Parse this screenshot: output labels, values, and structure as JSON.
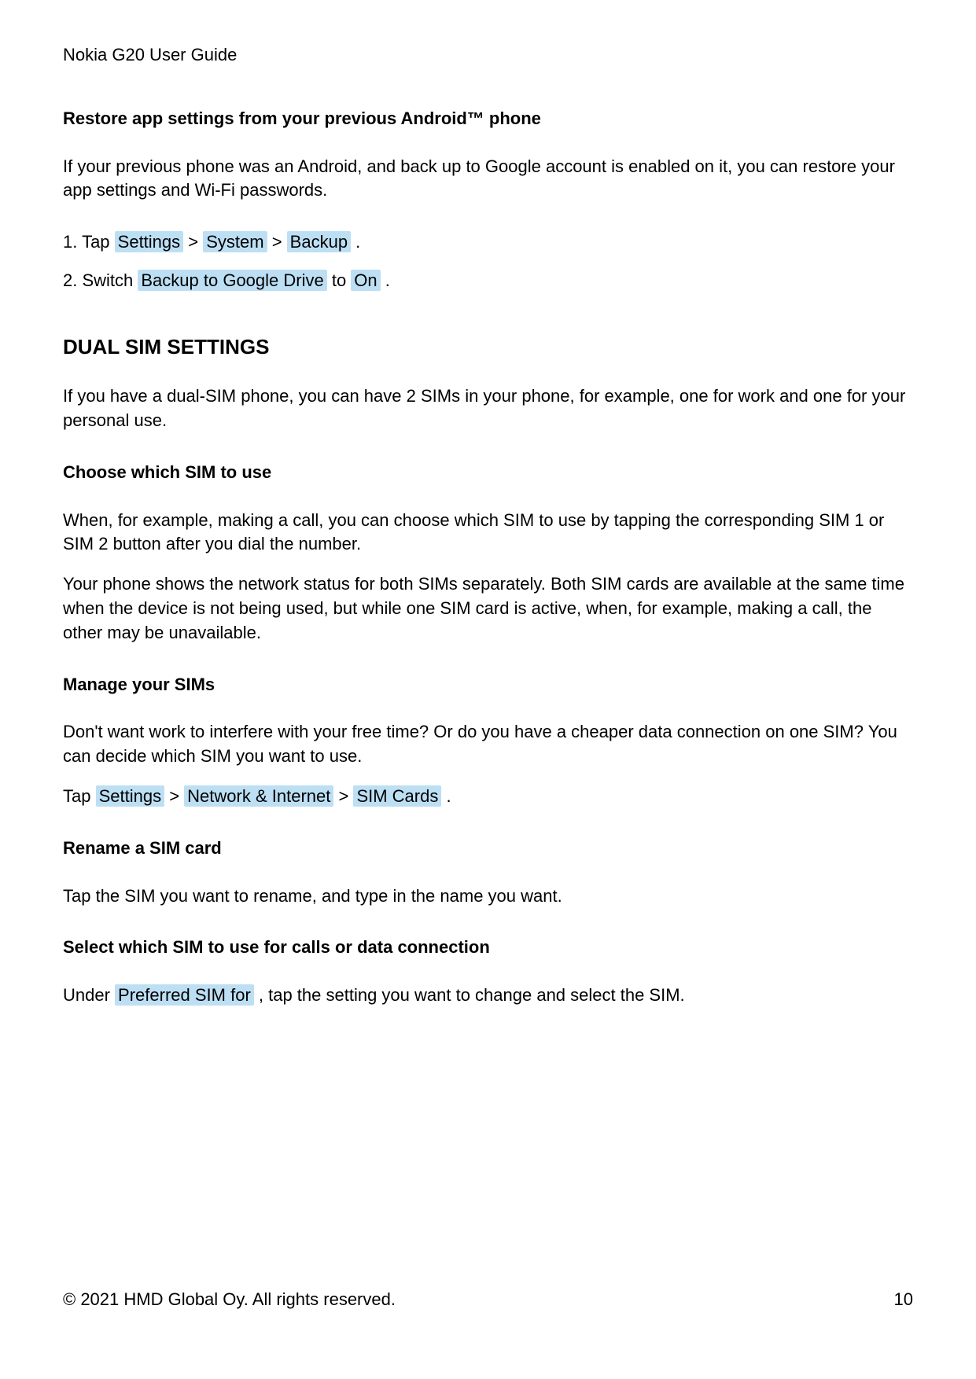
{
  "header": {
    "title": "Nokia G20 User Guide"
  },
  "section1": {
    "heading": "Restore app settings from your previous Android™ phone",
    "text1": "If your previous phone was an Android, and back up to Google account is enabled on it, you can restore your app settings and Wi-Fi passwords.",
    "list": {
      "item1_prefix": "1.  Tap ",
      "item1_hl1": "Settings",
      "item1_sep1": " > ",
      "item1_hl2": "System",
      "item1_sep2": " > ",
      "item1_hl3": "Backup",
      "item1_suffix": " .",
      "item2_prefix": "2.  Switch ",
      "item2_hl1": "Backup to Google Drive",
      "item2_mid": "  to ",
      "item2_hl2": "On",
      "item2_suffix": " ."
    }
  },
  "section2": {
    "heading": "DUAL SIM SETTINGS",
    "text1": "If you have a dual-SIM phone, you can have 2 SIMs in your phone, for example, one for work and one for your personal use."
  },
  "section3": {
    "heading": "Choose which SIM to use",
    "text1": "When, for example, making a call, you can choose which SIM to use by tapping the corresponding SIM 1 or SIM 2 button after you dial the number.",
    "text2": "Your phone shows the network status for both SIMs separately. Both SIM cards are available at the same time when the device is not being used, but while one SIM card is active, when, for example, making a call, the other may be unavailable."
  },
  "section4": {
    "heading": "Manage your SIMs",
    "text1": "Don't want work to interfere with your free time? Or do you have a cheaper data connection on one SIM? You can decide which SIM you want to use.",
    "tap_prefix": "Tap ",
    "tap_hl1": "Settings",
    "tap_sep1": " > ",
    "tap_hl2": "Network & Internet",
    "tap_sep2": " > ",
    "tap_hl3": "SIM Cards",
    "tap_suffix": " ."
  },
  "section5": {
    "heading": "Rename a SIM card",
    "text1": "Tap the SIM you want to rename, and type in the name you want."
  },
  "section6": {
    "heading": "Select which SIM to use for calls or data connection",
    "text_prefix": "Under ",
    "text_hl1": "Preferred SIM for",
    "text_suffix": " , tap the setting you want to change and select the SIM."
  },
  "footer": {
    "copyright": "© 2021 HMD Global Oy. All rights reserved.",
    "pageNumber": "10"
  }
}
